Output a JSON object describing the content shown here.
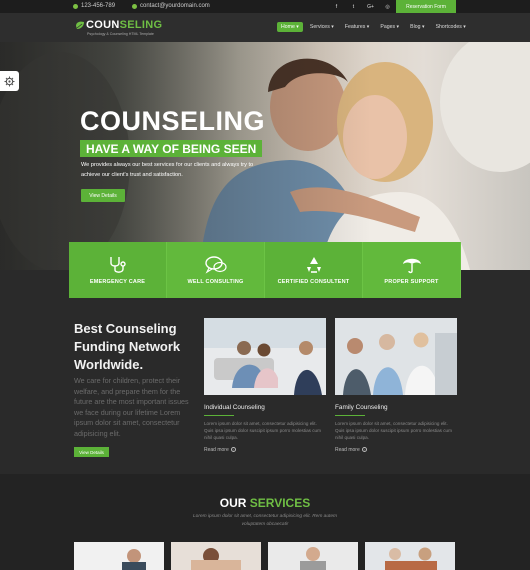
{
  "topbar": {
    "phone": "123-456-789",
    "email": "contact@yourdomain.com",
    "social": [
      "f",
      "t",
      "G+",
      "◎",
      "in"
    ],
    "reservation_label": "Reservation Form"
  },
  "header": {
    "logo_main": "COUN",
    "logo_accent": "SELING",
    "tagline": "Psychology & Counseling HTML Template",
    "nav": [
      {
        "label": "Home ▾"
      },
      {
        "label": "Services ▾"
      },
      {
        "label": "Features ▾"
      },
      {
        "label": "Pages ▾"
      },
      {
        "label": "Blog ▾"
      },
      {
        "label": "Shortcodes ▾"
      }
    ]
  },
  "hero": {
    "title": "COUNSELING",
    "subtitle": "HAVE A WAY OF BEING SEEN",
    "text": "We provides always our best services for our clients and always try to achieve our client's trust and satisfaction.",
    "button": "View Details"
  },
  "features": [
    {
      "label": "EMERGENCY CARE",
      "icon": "stethoscope-icon"
    },
    {
      "label": "WELL CONSULTING",
      "icon": "chat-bubbles-icon"
    },
    {
      "label": "CERTIFIED CONSULTENT",
      "icon": "recycle-icon"
    },
    {
      "label": "PROPER SUPPORT",
      "icon": "umbrella-icon"
    }
  ],
  "intro": {
    "title": "Best Counseling Funding Network Worldwide.",
    "text": "We care for children, protect their welfare, and prepare them for the future are the most important issues we face during our lifetime Lorem ipsum dolor sit amet, consectetur adipisicing elit.",
    "button": "View Details"
  },
  "cards": [
    {
      "title": "Individual Counseling",
      "text": "Lorem ipsum dolor sit amet, consectetur adipisicing elit. Quis ipsa ipsum dolor suscipit ipsum porro molestias cum nihil quasi culpa.",
      "more": "Read more"
    },
    {
      "title": "Family Counseling",
      "text": "Lorem ipsum dolor sit amet, consectetur adipisicing elit. Quis ipsa ipsum dolor suscipit ipsum porro molestias cum nihil quasi culpa.",
      "more": "Read more"
    }
  ],
  "services": {
    "title_main": "OUR ",
    "title_accent": "SERVICES",
    "text": "Lorem ipsum dolor sit amet, consectetur adipisicing elit. Rem autem voluptatem obcaecati!"
  },
  "colors": {
    "accent": "#5cb238",
    "dark_bg": "#2a2a2a",
    "topbar_bg": "#1d1d1d"
  }
}
